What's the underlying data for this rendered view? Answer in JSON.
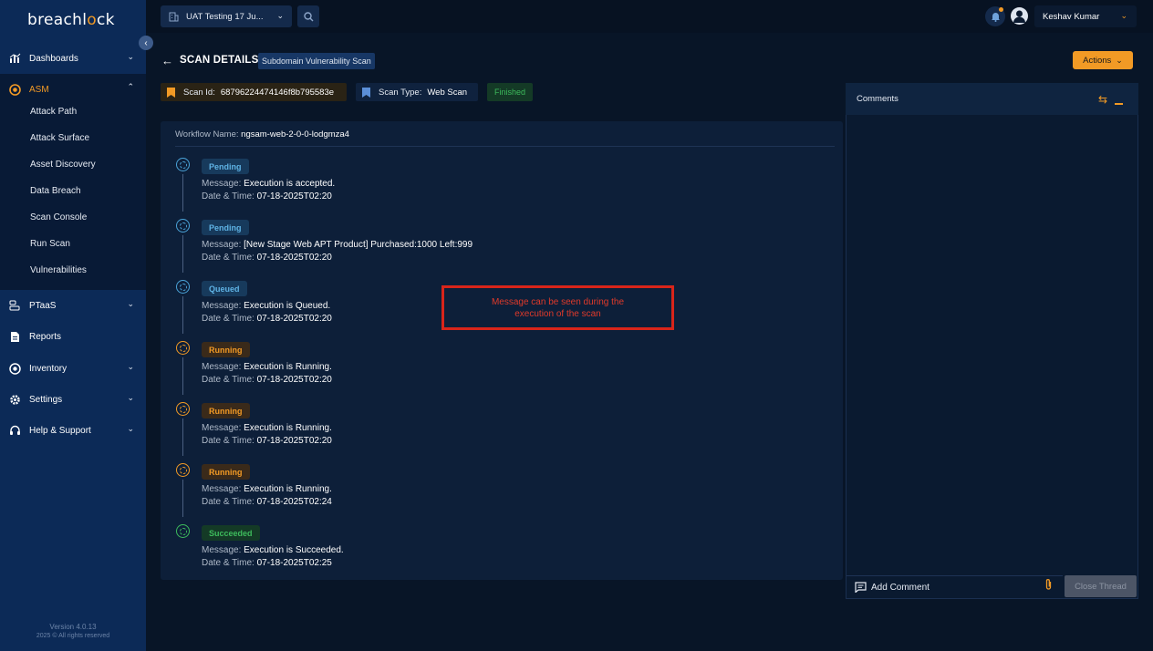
{
  "brand": {
    "logo_prefix": "breachl",
    "logo_o": "o",
    "logo_suffix": "ck"
  },
  "sidebar": {
    "items": [
      {
        "label": "Dashboards"
      },
      {
        "label": "ASM"
      },
      {
        "label": "PTaaS"
      },
      {
        "label": "Reports"
      },
      {
        "label": "Inventory"
      },
      {
        "label": "Settings"
      },
      {
        "label": "Help & Support"
      }
    ],
    "asm_sub": [
      "Attack Path",
      "Attack Surface",
      "Asset Discovery",
      "Data Breach",
      "Scan Console",
      "Run Scan",
      "Vulnerabilities"
    ],
    "version": "Version 4.0.13",
    "copyright": "2025 © All rights reserved"
  },
  "topbar": {
    "workspace": "UAT Testing 17 Ju...",
    "user_name": "Keshav Kumar"
  },
  "header": {
    "title": "SCAN DETAILS",
    "subtitle": "Subdomain Vulnerability Scan",
    "actions_label": "Actions",
    "scan_id_label": "Scan Id:",
    "scan_id": "68796224474146f8b795583e",
    "scan_type_label": "Scan Type:",
    "scan_type": "Web Scan",
    "status": "Finished"
  },
  "workflow": {
    "label": "Workflow Name:",
    "value": "ngsam-web-2-0-0-lodgmza4"
  },
  "timeline_labels": {
    "message": "Message: ",
    "datetime": "Date & Time: "
  },
  "timeline": [
    {
      "status": "Pending",
      "message": "Execution is accepted.",
      "datetime": "07-18-2025T02:20"
    },
    {
      "status": "Pending",
      "message": "[New Stage Web APT Product] Purchased:1000 Left:999",
      "datetime": "07-18-2025T02:20"
    },
    {
      "status": "Queued",
      "message": "Execution is Queued.",
      "datetime": "07-18-2025T02:20"
    },
    {
      "status": "Running",
      "message": "Execution is Running.",
      "datetime": "07-18-2025T02:20"
    },
    {
      "status": "Running",
      "message": "Execution is Running.",
      "datetime": "07-18-2025T02:20"
    },
    {
      "status": "Running",
      "message": "Execution is Running.",
      "datetime": "07-18-2025T02:24"
    },
    {
      "status": "Succeeded",
      "message": "Execution is Succeeded.",
      "datetime": "07-18-2025T02:25"
    }
  ],
  "annotation": {
    "line1": "Message can be seen during the",
    "line2": "execution of the scan"
  },
  "comments": {
    "title": "Comments",
    "add_comment": "Add Comment",
    "close_thread": "Close Thread"
  },
  "colors": {
    "accent": "#f29a25",
    "sidebar": "#0c2a57",
    "background": "#081527"
  }
}
